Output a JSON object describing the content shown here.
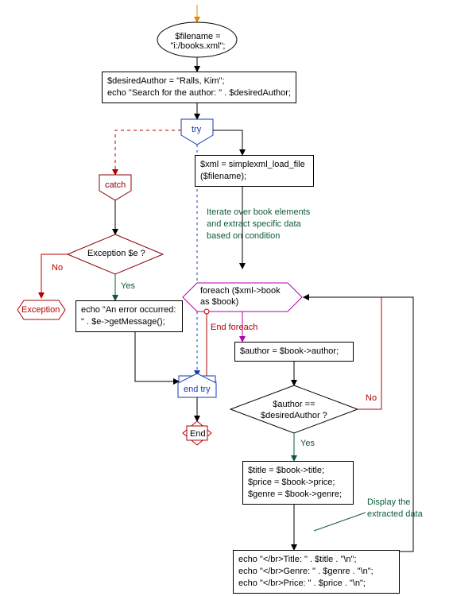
{
  "nodes": {
    "start_line1": "$filename =",
    "start_line2": "\"i:/books.xml\";",
    "assign1_line1": "$desiredAuthor = \"Ralls, Kim\";",
    "assign1_line2": "echo \"Search for the author: \" . $desiredAuthor;",
    "try_label": "try",
    "catch_label": "catch",
    "load_line1": "$xml = simplexml_load_file",
    "load_line2": "($filename);",
    "comment1_line1": "Iterate over book elements",
    "comment1_line2": "and extract specific data",
    "comment1_line3": "based on condition",
    "exception_q": "Exception $e ?",
    "yes": "Yes",
    "no": "No",
    "exception_label": "Exception",
    "err_line1": "echo \"An error occurred:",
    "err_line2": "\" . $e->getMessage();",
    "foreach_line1": "foreach ($xml->book",
    "foreach_line2": "as $book)",
    "end_foreach_label": "End foreach",
    "author_assign": "$author = $book->author;",
    "endtry_label": "end try",
    "author_q_line1": "$author ==",
    "author_q_line2": "$desiredAuthor ?",
    "end_label": "End",
    "block_line1": "$title = $book->title;",
    "block_line2": "$price = $book->price;",
    "block_line3": "$genre = $book->genre;",
    "comment2_line1": "Display the",
    "comment2_line2": "extracted data",
    "echo_line1": "echo \"</br>Title: \" . $title . \"\\n\";",
    "echo_line2": "echo \"</br>Genre: \" . $genre . \"\\n\";",
    "echo_line3": "echo \"</br>Price: \" . $price . \"\\n\";"
  },
  "chart_data": {
    "type": "flowchart",
    "title": "",
    "nodes": [
      {
        "id": "start",
        "kind": "terminator",
        "text": "$filename = \"i:/books.xml\";"
      },
      {
        "id": "assign",
        "kind": "process",
        "text": "$desiredAuthor = \"Ralls, Kim\"; echo \"Search for the author: \" . $desiredAuthor;"
      },
      {
        "id": "try",
        "kind": "pentagon",
        "text": "try"
      },
      {
        "id": "load",
        "kind": "process",
        "text": "$xml = simplexml_load_file($filename);"
      },
      {
        "id": "comment1",
        "kind": "comment",
        "text": "Iterate over book elements and extract specific data based on condition"
      },
      {
        "id": "foreach",
        "kind": "loop",
        "text": "foreach ($xml->book as $book)"
      },
      {
        "id": "author",
        "kind": "process",
        "text": "$author = $book->author;"
      },
      {
        "id": "authorq",
        "kind": "decision",
        "text": "$author == $desiredAuthor ?"
      },
      {
        "id": "block",
        "kind": "process",
        "text": "$title = $book->title; $price = $book->price; $genre = $book->genre;"
      },
      {
        "id": "comment2",
        "kind": "comment",
        "text": "Display the extracted data"
      },
      {
        "id": "echo",
        "kind": "process",
        "text": "echo \"</br>Title: \" . $title . \"\\n\"; echo \"</br>Genre: \" . $genre . \"\\n\"; echo \"</br>Price: \" . $price . \"\\n\";"
      },
      {
        "id": "catch",
        "kind": "pentagon",
        "text": "catch"
      },
      {
        "id": "exq",
        "kind": "decision",
        "text": "Exception $e ?"
      },
      {
        "id": "err",
        "kind": "process",
        "text": "echo \"An error occurred: \" . $e->getMessage();"
      },
      {
        "id": "exception",
        "kind": "exception",
        "text": "Exception"
      },
      {
        "id": "endtry",
        "kind": "pentagon",
        "text": "end try"
      },
      {
        "id": "end",
        "kind": "terminator",
        "text": "End"
      }
    ],
    "edges": [
      {
        "from": "start",
        "to": "assign"
      },
      {
        "from": "assign",
        "to": "try"
      },
      {
        "from": "try",
        "to": "load"
      },
      {
        "from": "try",
        "to": "catch",
        "style": "dashed"
      },
      {
        "from": "load",
        "to": "foreach",
        "via": "comment1"
      },
      {
        "from": "foreach",
        "to": "author"
      },
      {
        "from": "author",
        "to": "authorq"
      },
      {
        "from": "authorq",
        "to": "block",
        "label": "Yes"
      },
      {
        "from": "authorq",
        "to": "foreach",
        "label": "No"
      },
      {
        "from": "block",
        "to": "echo",
        "via": "comment2"
      },
      {
        "from": "echo",
        "to": "foreach"
      },
      {
        "from": "foreach",
        "to": "endtry",
        "label": "End foreach"
      },
      {
        "from": "catch",
        "to": "exq"
      },
      {
        "from": "exq",
        "to": "err",
        "label": "Yes"
      },
      {
        "from": "exq",
        "to": "exception",
        "label": "No"
      },
      {
        "from": "err",
        "to": "endtry"
      },
      {
        "from": "try",
        "to": "endtry",
        "style": "dashed"
      },
      {
        "from": "endtry",
        "to": "end"
      }
    ]
  }
}
